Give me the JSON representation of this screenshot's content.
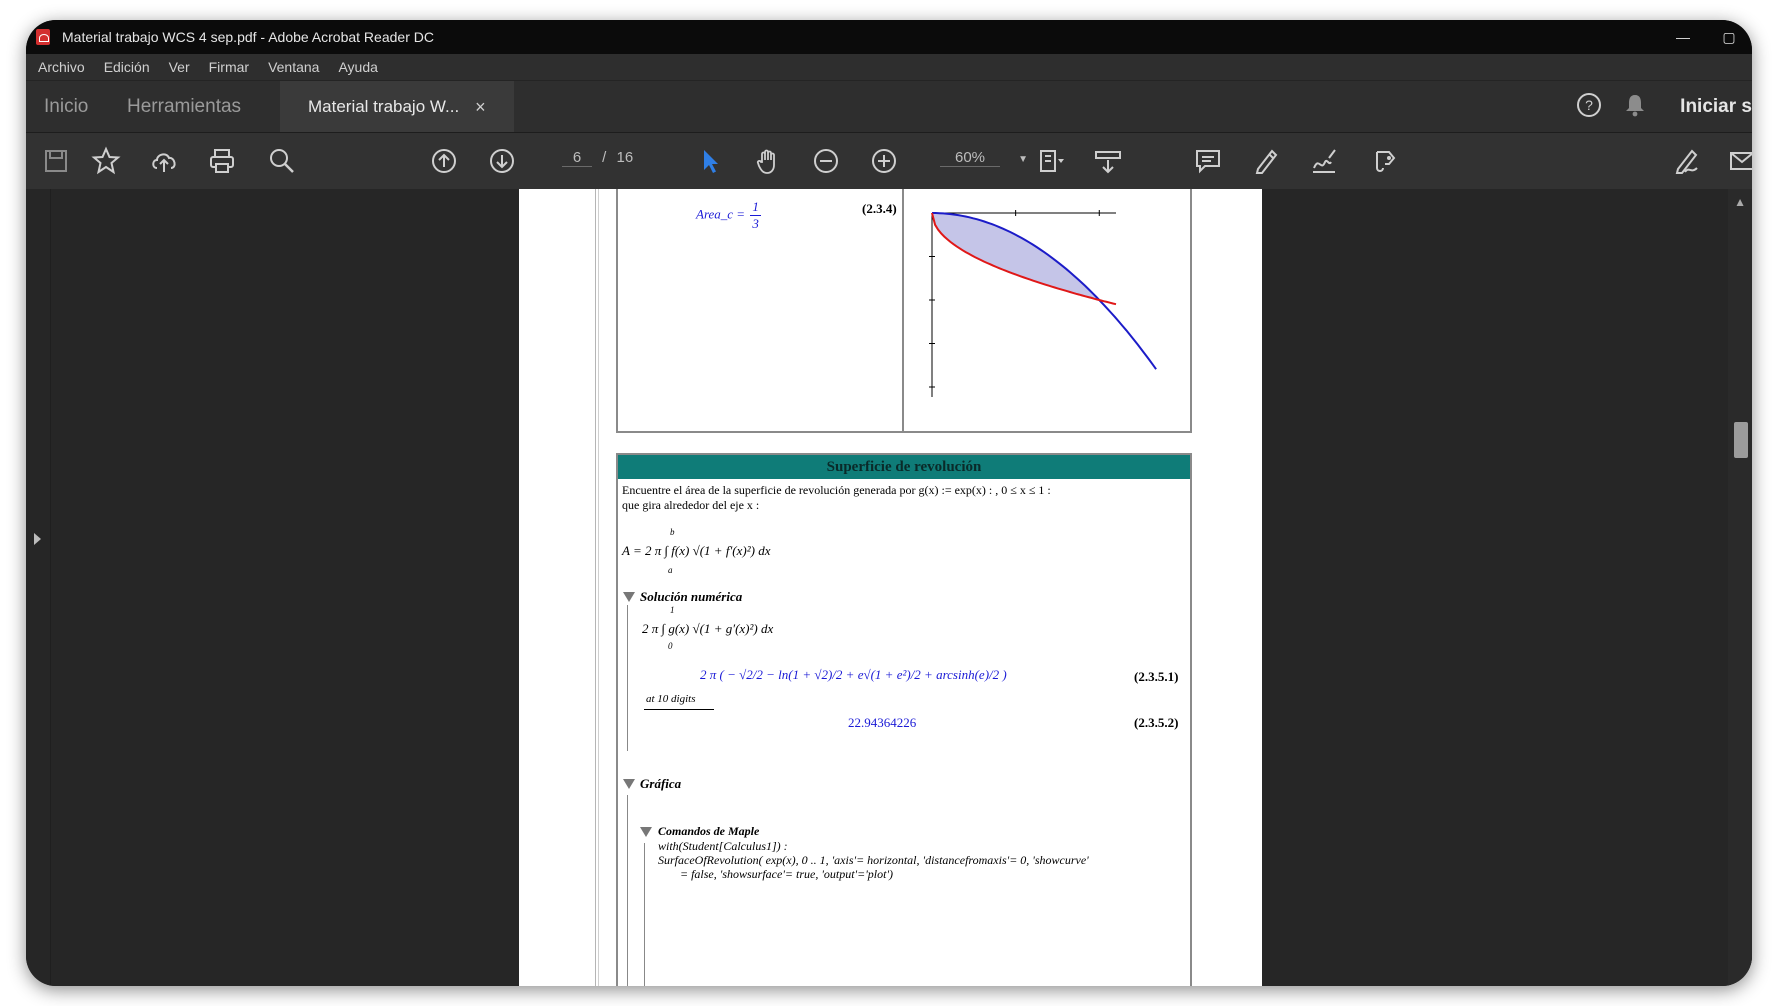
{
  "window": {
    "title": "Material trabajo WCS 4 sep.pdf - Adobe Acrobat Reader DC",
    "controls": [
      "—",
      "▢"
    ]
  },
  "menu": [
    "Archivo",
    "Edición",
    "Ver",
    "Firmar",
    "Ventana",
    "Ayuda"
  ],
  "tabs": {
    "inicio": "Inicio",
    "herramientas": "Herramientas",
    "document": "Material trabajo W...",
    "close": "×",
    "signin": "Iniciar s"
  },
  "toolbar": {
    "page_current": "6",
    "page_sep": "/",
    "page_total": "16",
    "zoom": "60%",
    "icons": [
      "save-icon",
      "bookmark-star-icon",
      "upload-cloud-icon",
      "print-icon",
      "search-zoom-icon",
      "page-up-icon",
      "page-down-icon",
      "select-arrow-icon",
      "hand-icon",
      "zoom-out-icon",
      "zoom-in-icon",
      "fit-page-icon",
      "scroll-mode-icon",
      "comment-icon",
      "highlight-pen-icon",
      "sign-icon",
      "share-icon",
      "fill-sign-icon",
      "email-icon"
    ]
  },
  "doc": {
    "area_label": "Area_c =",
    "area_num": "1",
    "area_den": "3",
    "eq_num_1": "(2.3.4)",
    "section_title": "Superficie de revolución",
    "problem_line1": "Encuentre el área de la superficie de revolución generada por g(x) := exp(x) : , 0 ≤ x ≤ 1 :",
    "problem_line2": "que gira alrededor del eje x :",
    "formula_A": "A = 2 π ∫ f(x) √(1 + f′(x)²) dx",
    "int_upper_a": "b",
    "int_lower_a": "a",
    "solucion": "Solución numérica",
    "formula_S": "2 π ∫ g(x) √(1 + g′(x)²) dx",
    "int_upper_s": "1",
    "int_lower_s": "0",
    "result_expr": "2 π ( − √2/2 − ln(1 + √2)/2 + e√(1 + e²)/2 + arcsinh(e)/2 )",
    "digits_label": "at 10 digits",
    "eq_num_2": "(2.3.5.1)",
    "result_value": "22.94364226",
    "eq_num_3": "(2.3.5.2)",
    "grafica": "Gráfica",
    "comandos": "Comandos de Maple",
    "cmd1": "with(Student[Calculus1]) :",
    "cmd2": "SurfaceOfRevolution( exp(x), 0 .. 1, 'axis'= horizontal, 'distancefromaxis'= 0, 'showcurve'",
    "cmd3": "= false, 'showsurface'= true, 'output'='plot')"
  },
  "chart_data": {
    "type": "line",
    "title": "",
    "xlabel": "",
    "ylabel": "",
    "xlim": [
      0,
      1.1
    ],
    "ylim": [
      -2,
      0
    ],
    "grid": false,
    "series": [
      {
        "color": "#1c1cc8",
        "x": [
          0,
          0.2,
          0.4,
          0.6,
          0.8,
          1.0,
          1.2,
          1.4,
          1.6
        ],
        "y": [
          0,
          -0.04,
          -0.16,
          -0.36,
          -0.64,
          -1.0,
          -1.44,
          -1.96,
          -2.56
        ]
      },
      {
        "color": "#e01818",
        "x": [
          0,
          0.1,
          0.2,
          0.4,
          0.6,
          0.8,
          1.0,
          1.2
        ],
        "y": [
          0,
          -0.32,
          -0.45,
          -0.63,
          -0.77,
          -0.89,
          -1.0,
          -1.1
        ]
      }
    ],
    "shade_between": [
      0,
      1
    ],
    "shade_color": "#c5c5e8"
  }
}
